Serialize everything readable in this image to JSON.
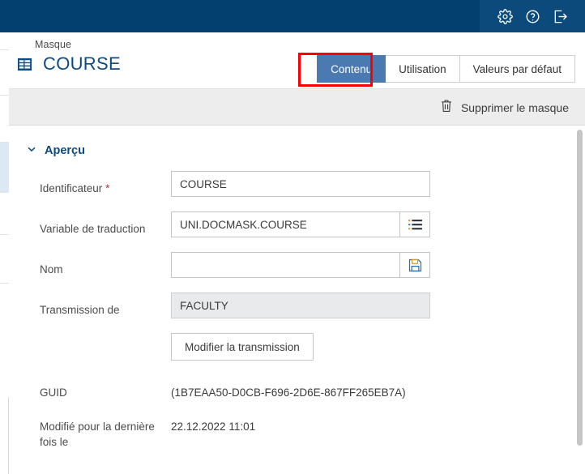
{
  "topbar": {
    "icons": [
      {
        "name": "settings-icon",
        "label": "Paramètres"
      },
      {
        "name": "help-icon",
        "label": "Aide"
      },
      {
        "name": "logout-icon",
        "label": "Déconnexion"
      }
    ],
    "background_color": "#04406f"
  },
  "header": {
    "breadcrumb": "Masque",
    "title": "COURSE",
    "title_icon": "table-icon",
    "title_color": "#0c4a80"
  },
  "tabs": [
    {
      "label": "Contenu",
      "active": true
    },
    {
      "label": "Utilisation",
      "active": false
    },
    {
      "label": "Valeurs par défaut",
      "active": false
    }
  ],
  "tab_active_color": "#4a7ab0",
  "highlight_color": "#ff0000",
  "actionbar": {
    "delete_label": "Supprimer le masque",
    "delete_icon": "trash-icon"
  },
  "section": {
    "title": "Aperçu",
    "collapse_icon": "chevron-down-icon",
    "expanded": true
  },
  "fields": {
    "identifier": {
      "label": "Identificateur",
      "required_marker": "*",
      "value": "COURSE"
    },
    "translation_variable": {
      "label": "Variable de traduction",
      "value": "UNI.DOCMASK.COURSE",
      "button_icon": "list-icon"
    },
    "name": {
      "label": "Nom",
      "value": "",
      "placeholder": "",
      "button_icon": "save-icon"
    },
    "transmission_from": {
      "label": "Transmission de",
      "value": "FACULTY",
      "readonly": true
    },
    "edit_transmission_button": {
      "label": "Modifier la transmission"
    },
    "guid": {
      "label": "GUID",
      "value": "(1B7EAA50-D0CB-F696-2D6E-867FF265EB7A)"
    },
    "last_modified": {
      "label": "Modifié pour la dernière fois le",
      "value": "22.12.2022 11:01"
    }
  }
}
